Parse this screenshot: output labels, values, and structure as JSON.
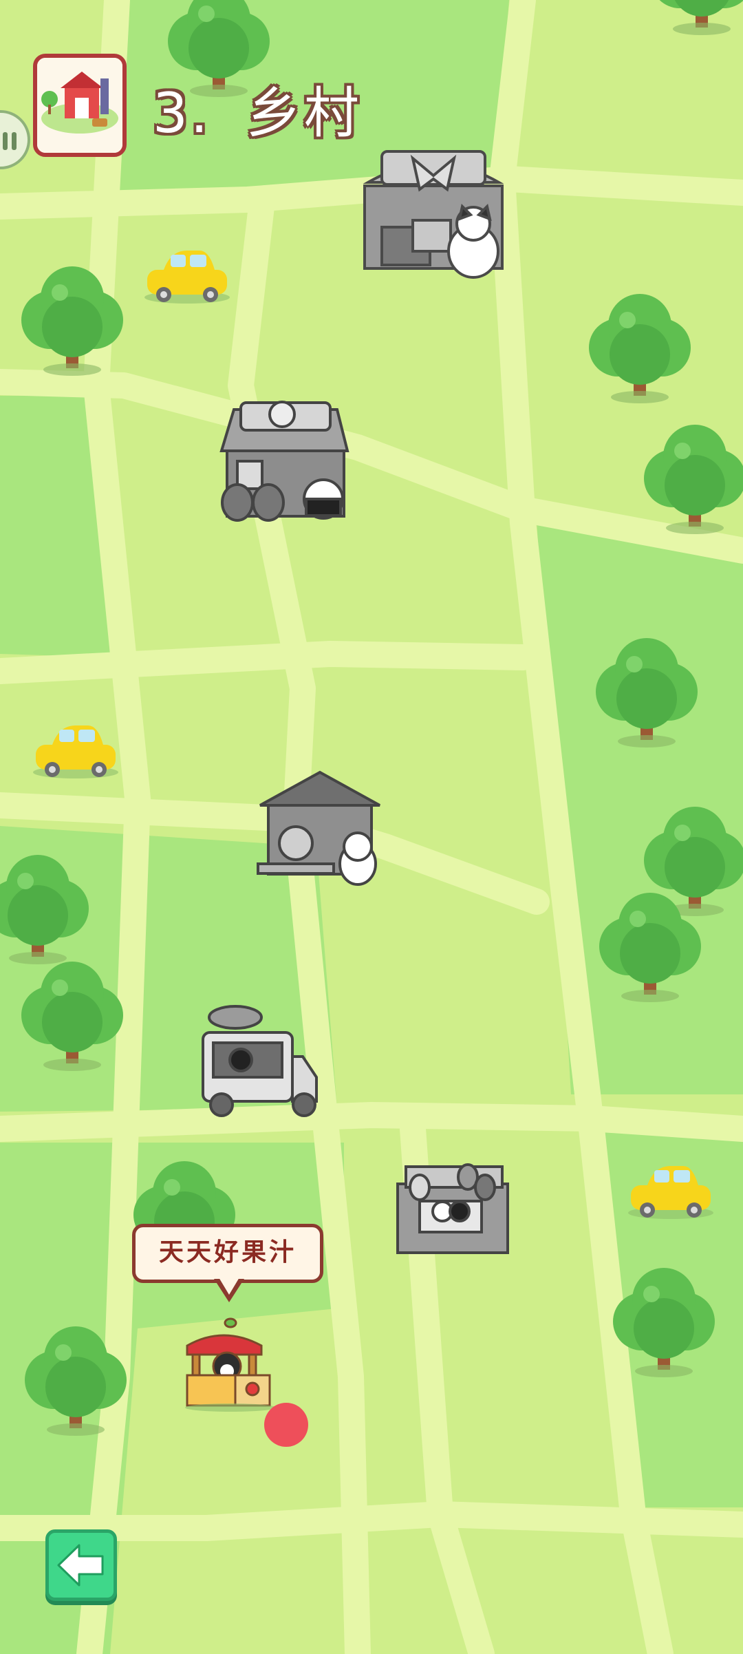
{
  "level": {
    "number": "3.",
    "name": "乡村"
  },
  "selected_shop": {
    "name": "天天好果汁"
  },
  "icons": {
    "pause": "pause-icon",
    "back": "back-arrow-icon",
    "level": "farm-barn-icon"
  },
  "colors": {
    "grass_light": "#cfee8a",
    "grass_dark": "#a9e67e",
    "road": "#e4f6a4",
    "tree": "#5fbf50",
    "trunk": "#9b5a34",
    "car": "#f7d51b",
    "accent_red": "#ee4f5a",
    "back_button": "#3fd78a"
  },
  "map": {
    "shops": [
      {
        "name": "bakery-stall",
        "locked": true
      },
      {
        "name": "clover-cottage",
        "locked": true
      },
      {
        "name": "bowling-house",
        "locked": true
      },
      {
        "name": "food-truck",
        "locked": true
      },
      {
        "name": "balloon-stand",
        "locked": true
      },
      {
        "name": "juice-stand",
        "locked": false
      }
    ],
    "cars": 3,
    "trees": 13
  }
}
